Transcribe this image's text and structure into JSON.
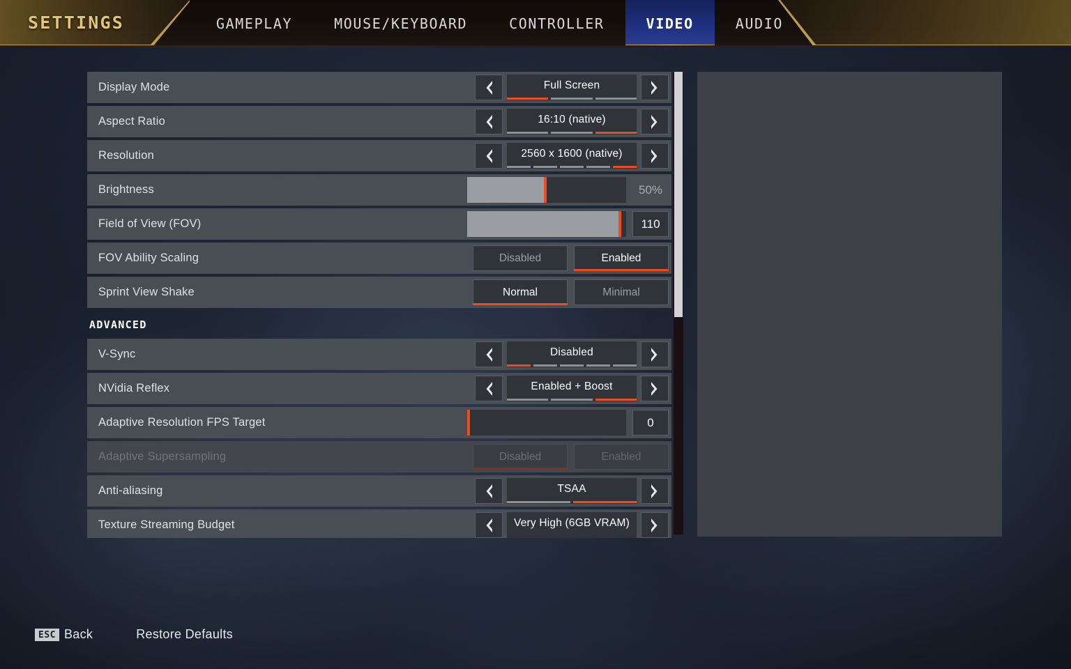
{
  "header": {
    "title": "SETTINGS",
    "tabs": [
      {
        "label": "GAMEPLAY",
        "active": false
      },
      {
        "label": "MOUSE/KEYBOARD",
        "active": false
      },
      {
        "label": "CONTROLLER",
        "active": false
      },
      {
        "label": "VIDEO",
        "active": true
      },
      {
        "label": "AUDIO",
        "active": false
      }
    ],
    "accent_gold": "#c9a84e",
    "active_tab_blue": "#1d2f7d"
  },
  "colors": {
    "row_bg": "#494d54",
    "control_bg": "#303338",
    "selected_orange": "#f04a1e",
    "segment_grey": "#8c9097",
    "slider_fill": "#9b9ea3",
    "preview_bg": "#3d4046",
    "scroll_thumb": "#d2d3d5"
  },
  "settings": {
    "rows": [
      {
        "id": "display-mode",
        "label": "Display Mode",
        "type": "spinner",
        "value": "Full Screen",
        "segments": 3,
        "selected_index": 0,
        "disabled": false
      },
      {
        "id": "aspect-ratio",
        "label": "Aspect Ratio",
        "type": "spinner",
        "value": "16:10 (native)",
        "segments": 3,
        "selected_index": 2,
        "disabled": false
      },
      {
        "id": "resolution",
        "label": "Resolution",
        "type": "spinner",
        "value": "2560 x 1600 (native)",
        "segments": 5,
        "selected_index": 4,
        "disabled": false
      },
      {
        "id": "brightness",
        "label": "Brightness",
        "type": "slider",
        "value": "50%",
        "fill_percent": 50,
        "boxed_value": false,
        "disabled": false
      },
      {
        "id": "field-of-view",
        "label": "Field of View (FOV)",
        "type": "slider",
        "value": "110",
        "fill_percent": 97,
        "boxed_value": true,
        "disabled": false
      },
      {
        "id": "fov-ability-scaling",
        "label": "FOV Ability Scaling",
        "type": "toggle",
        "options": [
          "Disabled",
          "Enabled"
        ],
        "selected_index": 1,
        "disabled": false
      },
      {
        "id": "sprint-view-shake",
        "label": "Sprint View Shake",
        "type": "toggle",
        "options": [
          "Normal",
          "Minimal"
        ],
        "selected_index": 0,
        "disabled": false
      },
      {
        "id": "advanced",
        "label": "ADVANCED",
        "type": "section"
      },
      {
        "id": "v-sync",
        "label": "V-Sync",
        "type": "spinner",
        "value": "Disabled",
        "segments": 5,
        "selected_index": 0,
        "disabled": false
      },
      {
        "id": "nvidia-reflex",
        "label": "NVidia Reflex",
        "type": "spinner",
        "value": "Enabled + Boost",
        "segments": 3,
        "selected_index": 2,
        "disabled": false
      },
      {
        "id": "adaptive-resolution-fps-target",
        "label": "Adaptive Resolution FPS Target",
        "type": "slider",
        "value": "0",
        "fill_percent": 0,
        "boxed_value": true,
        "disabled": false
      },
      {
        "id": "adaptive-supersampling",
        "label": "Adaptive Supersampling",
        "type": "toggle",
        "options": [
          "Disabled",
          "Enabled"
        ],
        "selected_index": 0,
        "disabled": true
      },
      {
        "id": "anti-aliasing",
        "label": "Anti-aliasing",
        "type": "spinner",
        "value": "TSAA",
        "segments": 2,
        "selected_index": 1,
        "disabled": false
      },
      {
        "id": "texture-streaming-budget",
        "label": "Texture Streaming Budget",
        "type": "spinner",
        "value": "Very High (6GB VRAM)",
        "segments": 0,
        "selected_index": -1,
        "disabled": false
      }
    ]
  },
  "scrollbar": {
    "thumb_percent": 53
  },
  "footer": {
    "esc_key": "ESC",
    "back_label": "Back",
    "restore_defaults": "Restore Defaults"
  }
}
